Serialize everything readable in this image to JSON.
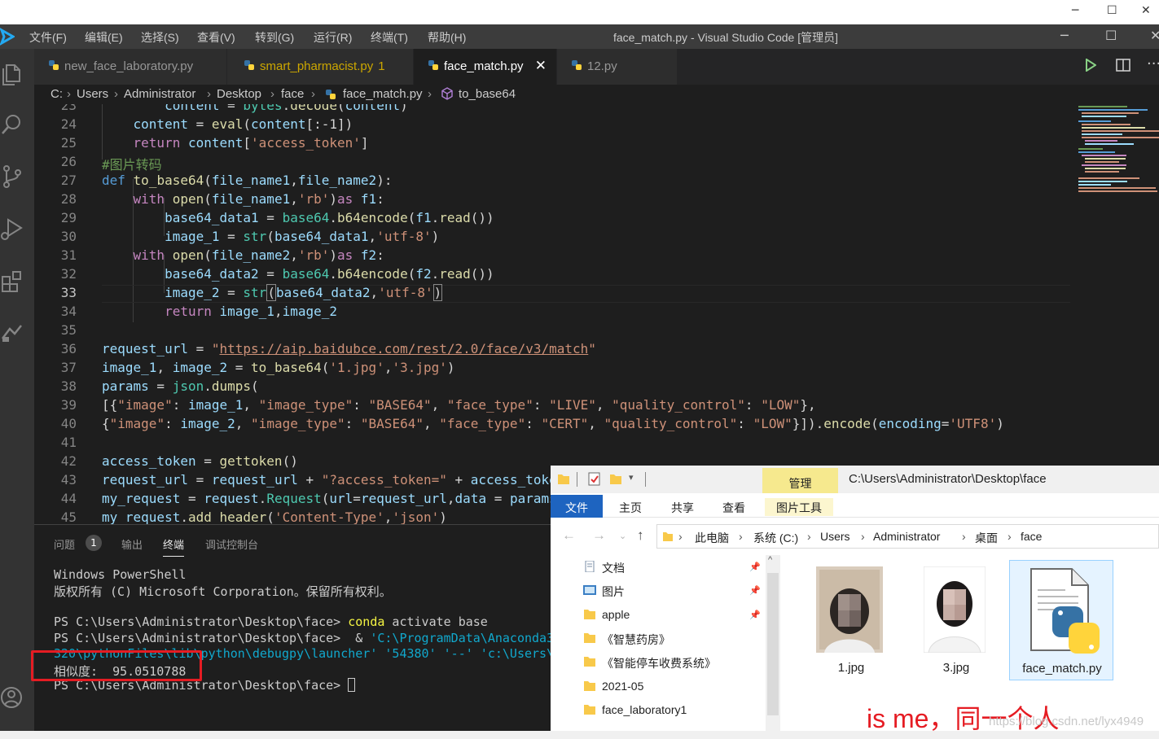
{
  "window": {
    "title": "face_match.py - Visual Studio Code [管理员]",
    "minimize": "─",
    "maximize": "☐",
    "close": "✕"
  },
  "menu": [
    "文件(F)",
    "编辑(E)",
    "选择(S)",
    "查看(V)",
    "转到(G)",
    "运行(R)",
    "终端(T)",
    "帮助(H)"
  ],
  "tabs": [
    {
      "label": "new_face_laboratory.py"
    },
    {
      "label": "smart_pharmacist.py",
      "count": "1"
    },
    {
      "label": "face_match.py",
      "close": "✕"
    },
    {
      "label": "12.py"
    }
  ],
  "breadcrumb": [
    "C:",
    "Users",
    "Administrator",
    "Desktop",
    "face",
    "face_match.py",
    "to_base64"
  ],
  "editor": {
    "line_numbers": [
      "23",
      "24",
      "25",
      "26",
      "27",
      "28",
      "29",
      "30",
      "31",
      "32",
      "33",
      "34",
      "35",
      "36",
      "37",
      "38",
      "39",
      "40",
      "41",
      "42",
      "43",
      "44",
      "45"
    ],
    "current_line": "33"
  },
  "panel": {
    "tabs": {
      "problems": "问题",
      "problems_count": "1",
      "output": "输出",
      "terminal": "终端",
      "debug": "调试控制台"
    },
    "lines": [
      "Windows PowerShell",
      "版权所有 (C) Microsoft Corporation。保留所有权利。",
      "",
      "PS C:\\Users\\Administrator\\Desktop\\face> ",
      "PS C:\\Users\\Administrator\\Desktop\\face>  & ",
      "320\\pythonFiles\\lib\\python\\debugpy\\launcher' '54380' '--' 'c:\\Users\\A",
      "相似度:  95.0510788",
      "PS C:\\Users\\Administrator\\Desktop\\face> "
    ],
    "conda_cmd": "conda",
    "conda_args": " activate base",
    "launch_path": "'C:\\ProgramData\\Anaconda3\\"
  },
  "explorer": {
    "manage_tab": "管理",
    "title_path": "C:\\Users\\Administrator\\Desktop\\face",
    "ribbon": {
      "file": "文件",
      "home": "主页",
      "share": "共享",
      "view": "查看",
      "picture_tools": "图片工具"
    },
    "address": [
      "此电脑",
      "系统 (C:)",
      "Users",
      "Administrator",
      "桌面",
      "face"
    ],
    "nav_items": [
      "文档",
      "图片",
      "apple",
      "《智慧药房》",
      "《智能停车收费系统》",
      "2021-05",
      "face_laboratory1"
    ],
    "files": [
      {
        "name": "1.jpg"
      },
      {
        "name": "3.jpg"
      },
      {
        "name": "face_match.py"
      }
    ],
    "annotation": "is me，同一个人",
    "watermark": "https://blog.csdn.net/lyx4949"
  },
  "colors": {
    "keyword": "#569cd6",
    "control": "#c586c0",
    "function": "#dcdcaa",
    "string": "#ce9178",
    "variable": "#9cdcfe",
    "comment": "#6a9955",
    "builtin": "#4ec9b0",
    "highlight": "#e51c23"
  }
}
